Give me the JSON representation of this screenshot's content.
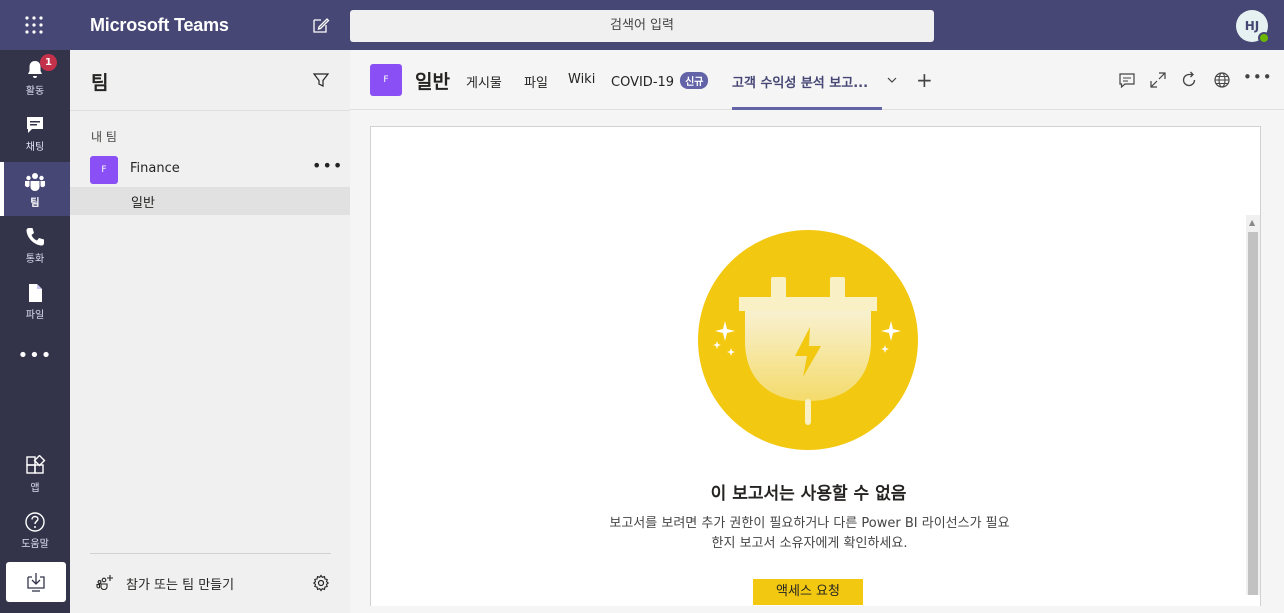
{
  "app": {
    "title": "Microsoft Teams"
  },
  "search": {
    "placeholder": "검색어 입력"
  },
  "user": {
    "initials": "HJ"
  },
  "rail": {
    "items": [
      {
        "label": "활동",
        "badge": "1"
      },
      {
        "label": "채팅"
      },
      {
        "label": "팀"
      },
      {
        "label": "통화"
      },
      {
        "label": "파일"
      }
    ],
    "bottom": [
      {
        "label": "앱"
      },
      {
        "label": "도움말"
      }
    ]
  },
  "panel": {
    "title": "팀",
    "section": "내 팀",
    "team": {
      "avatar": "F",
      "name": "Finance"
    },
    "channel": "일반",
    "join_label": "참가 또는 팀 만들기"
  },
  "channel_header": {
    "avatar": "F",
    "title": "일반",
    "tabs": [
      {
        "label": "게시물"
      },
      {
        "label": "파일"
      },
      {
        "label": "Wiki"
      },
      {
        "label": "COVID-19",
        "badge": "신규"
      },
      {
        "label": "고객 수익성 분석 보고..."
      }
    ]
  },
  "content": {
    "title": "이 보고서는 사용할 수 없음",
    "body": "보고서를 보려면 추가 권한이 필요하거나 다른 Power BI 라이선스가 필요한지 보고서 소유자에게 확인하세요.",
    "button": "액세스 요청"
  },
  "colors": {
    "header": "#464775",
    "rail": "#33344a",
    "accent": "#6264a7",
    "illustration": "#f2c811",
    "badge": "#c4314b"
  }
}
